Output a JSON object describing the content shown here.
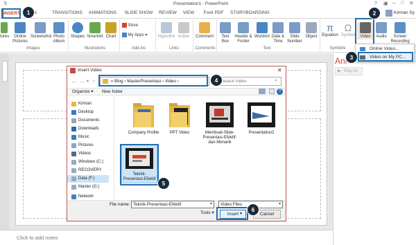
{
  "window": {
    "title": "Presentation1 - PowerPoint",
    "user": "Kirman Sy"
  },
  "tabs": [
    {
      "label": "INSERT"
    },
    {
      "label": "IGN"
    },
    {
      "label": "TRANSITIONS"
    },
    {
      "label": "ANIMATIONS"
    },
    {
      "label": "SLIDE SHOW"
    },
    {
      "label": "REVIEW"
    },
    {
      "label": "VIEW"
    },
    {
      "label": "Foxit PDF"
    },
    {
      "label": "STORYBOARDING"
    }
  ],
  "ribbon": {
    "tures": "tures",
    "online_pictures": "Online Pictures",
    "screenshot": "Screenshot",
    "photo_album": "Photo Album",
    "shapes": "Shapes",
    "smartart": "SmartArt",
    "chart": "Chart",
    "store": "Store",
    "my_apps": "My Apps",
    "hyperlink": "Hyperlink",
    "action": "Action",
    "comment": "Comment",
    "text_box": "Text Box",
    "header_footer": "Header & Footer",
    "wordart": "WordArt",
    "date_time": "Date & Time",
    "slide_number": "Slide Number",
    "object": "Object",
    "equation": "Equation",
    "symbol": "Symbol",
    "video": "Video",
    "audio": "Audio",
    "screen_recording": "Screen Recording"
  },
  "groups": {
    "images": "Images",
    "illustrations": "Illustrations",
    "addins": "Add-ins",
    "links": "Links",
    "comments": "Comments",
    "text": "Text",
    "symbols": "Symbols"
  },
  "video_menu": {
    "online": "Online Video...",
    "my_pc": "Video on My PC..."
  },
  "right_pane": {
    "title": "Ani",
    "play_all": "Play All"
  },
  "notes": {
    "placeholder": "Click to add notes"
  },
  "dialog": {
    "title": "Insert Video",
    "path": [
      "«",
      "Blog",
      "›",
      "MasterPresentasi",
      "›",
      "Video",
      "›"
    ],
    "search_placeholder": "Search Video",
    "organize": "Organize ▾",
    "new_folder": "New folder",
    "nav": [
      {
        "label": "Kirman"
      },
      {
        "label": "Desktop"
      },
      {
        "label": "Documents"
      },
      {
        "label": "Downloads"
      },
      {
        "label": "Music"
      },
      {
        "label": "Pictures"
      },
      {
        "label": "Videos"
      },
      {
        "label": "Windows (C:)"
      },
      {
        "label": "RECOVERY (D:)"
      },
      {
        "label": "Data (F:)"
      },
      {
        "label": "Master (G:)"
      },
      {
        "label": "Network"
      }
    ],
    "files": [
      {
        "name": "Company Profile"
      },
      {
        "name": "PPT Video"
      },
      {
        "name": "Membuat-Slide-Presentasi-Efektif-dan-Menarik"
      },
      {
        "name": "Presentation2"
      },
      {
        "name": "Teknik-Presentasi-Efektif"
      }
    ],
    "file_name_label": "File name:",
    "file_name_value": "Teknik-Presentasi-Efektif",
    "file_type": "Video Files",
    "tools": "Tools",
    "insert": "Insert",
    "cancel": "Cancel"
  },
  "steps": [
    "1",
    "2",
    "3",
    "4",
    "5",
    "6"
  ],
  "colors": {
    "accent": "#d24726",
    "highlight": "#1f6fb2",
    "badge": "#1b2a3a"
  }
}
